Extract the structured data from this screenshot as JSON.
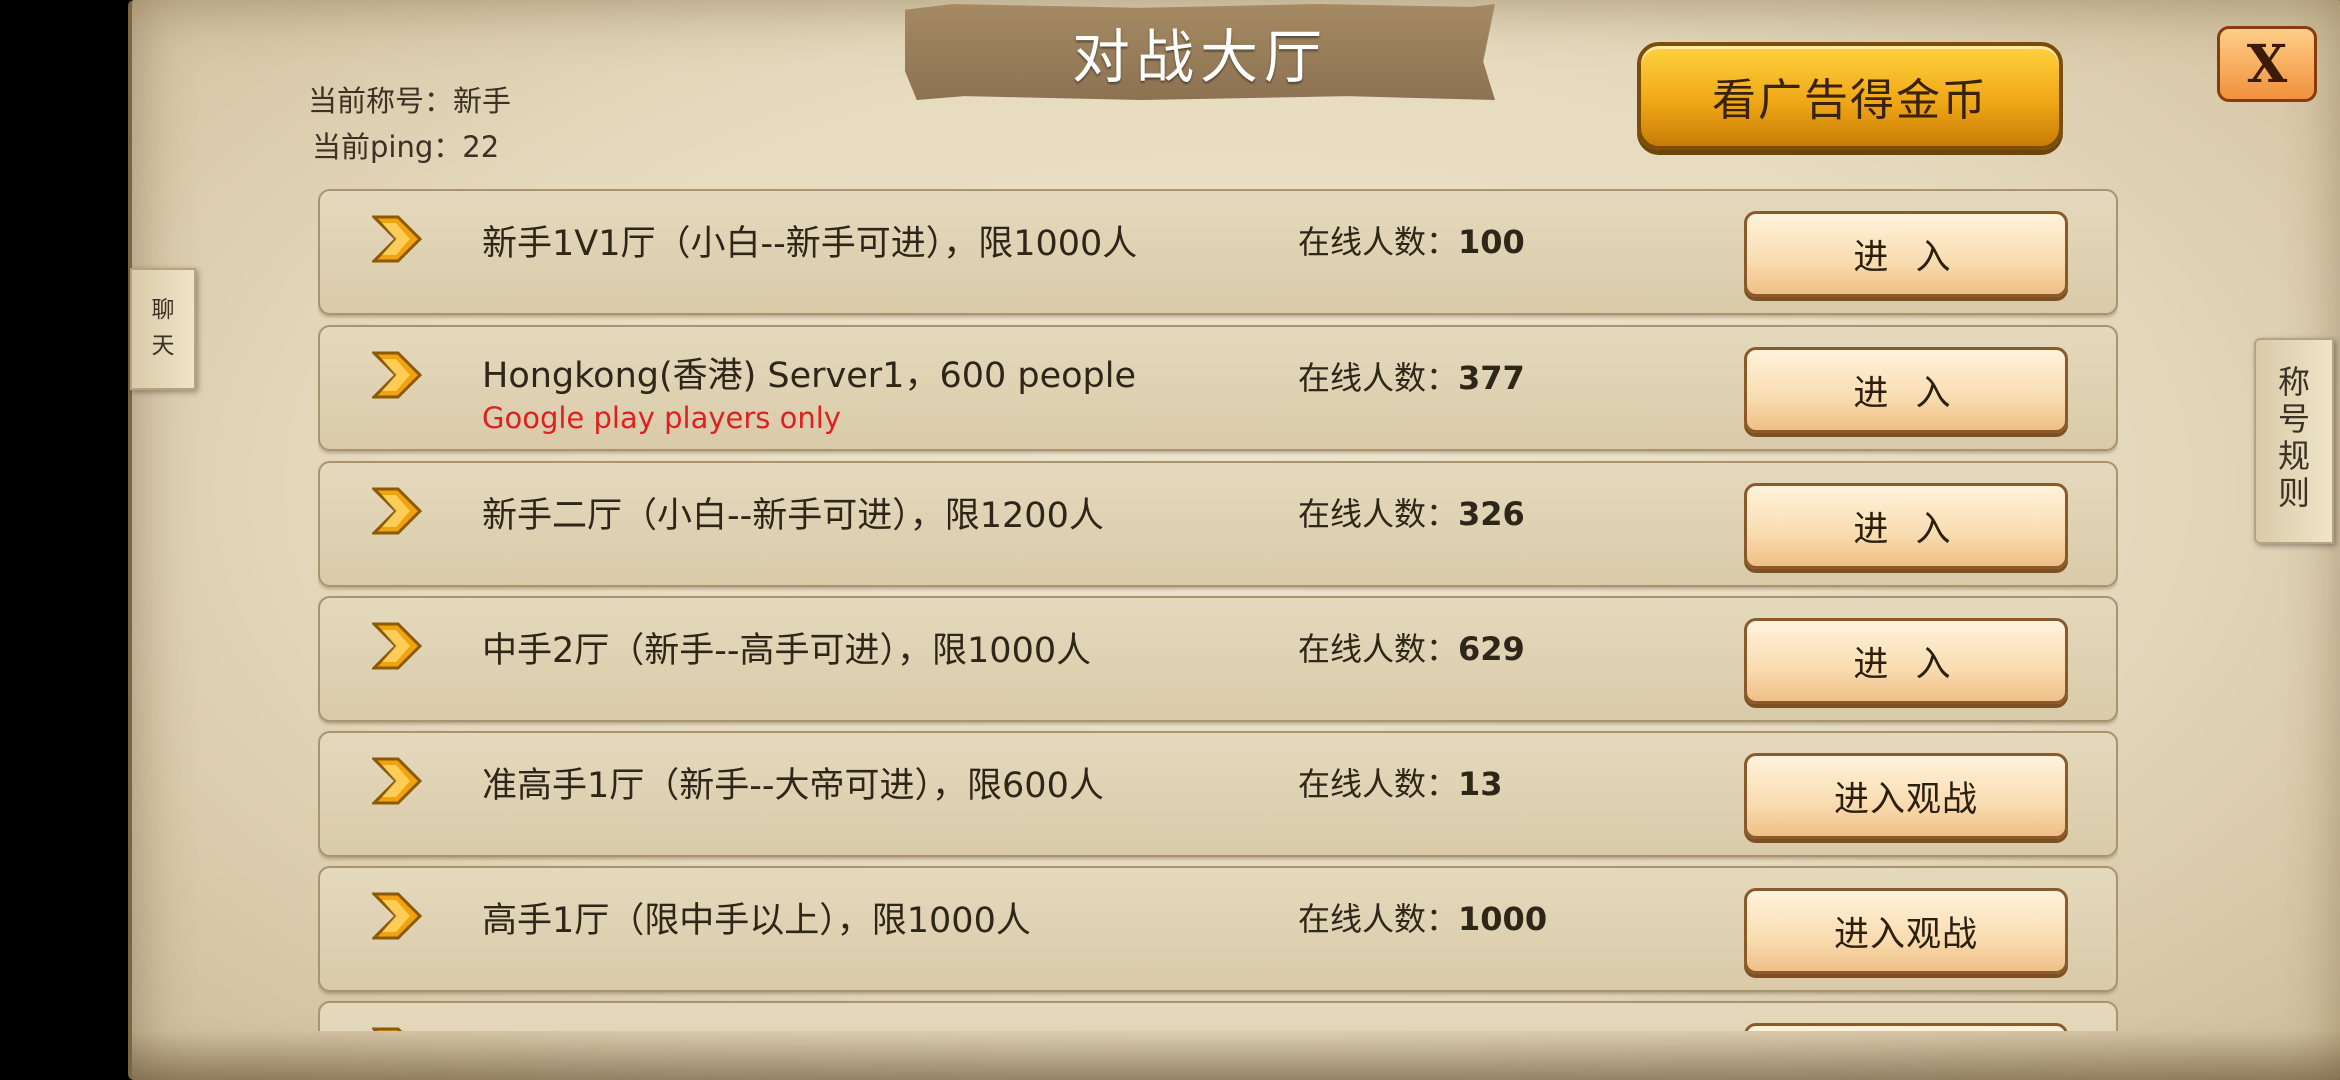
{
  "header": {
    "title": "对战大厅",
    "title_label": "当前称号：",
    "title_value": "新手",
    "ping_label": "当前ping：",
    "ping_value": "22",
    "ad_button": "看广告得金币",
    "close_button": "X"
  },
  "side_tabs": {
    "chat": [
      "聊",
      "天"
    ],
    "rules": [
      "称",
      "号",
      "规",
      "则"
    ]
  },
  "rooms": [
    {
      "name": "新手1V1厅（小白--新手可进），限1000人",
      "subtitle": "",
      "online_label": "在线人数：",
      "online_count": "100",
      "button": "进 入"
    },
    {
      "name": "Hongkong(香港) Server1，600 people",
      "subtitle": "Google play players only",
      "online_label": "在线人数：",
      "online_count": "377",
      "button": "进 入"
    },
    {
      "name": "新手二厅（小白--新手可进），限1200人",
      "subtitle": "",
      "online_label": "在线人数：",
      "online_count": "326",
      "button": "进 入"
    },
    {
      "name": "中手2厅（新手--高手可进），限1000人",
      "subtitle": "",
      "online_label": "在线人数：",
      "online_count": "629",
      "button": "进 入"
    },
    {
      "name": "准高手1厅（新手--大帝可进），限600人",
      "subtitle": "",
      "online_label": "在线人数：",
      "online_count": "13",
      "button": "进入观战"
    },
    {
      "name": "高手1厅（限中手以上），限1000人",
      "subtitle": "",
      "online_label": "在线人数：",
      "online_count": "1000",
      "button": "进入观战"
    }
  ],
  "colors": {
    "parchment": "#e6dabe",
    "gold_button": "#f0a817",
    "subtitle_red": "#e02020"
  },
  "icons": {
    "row_arrow": "chevron-right-icon"
  }
}
